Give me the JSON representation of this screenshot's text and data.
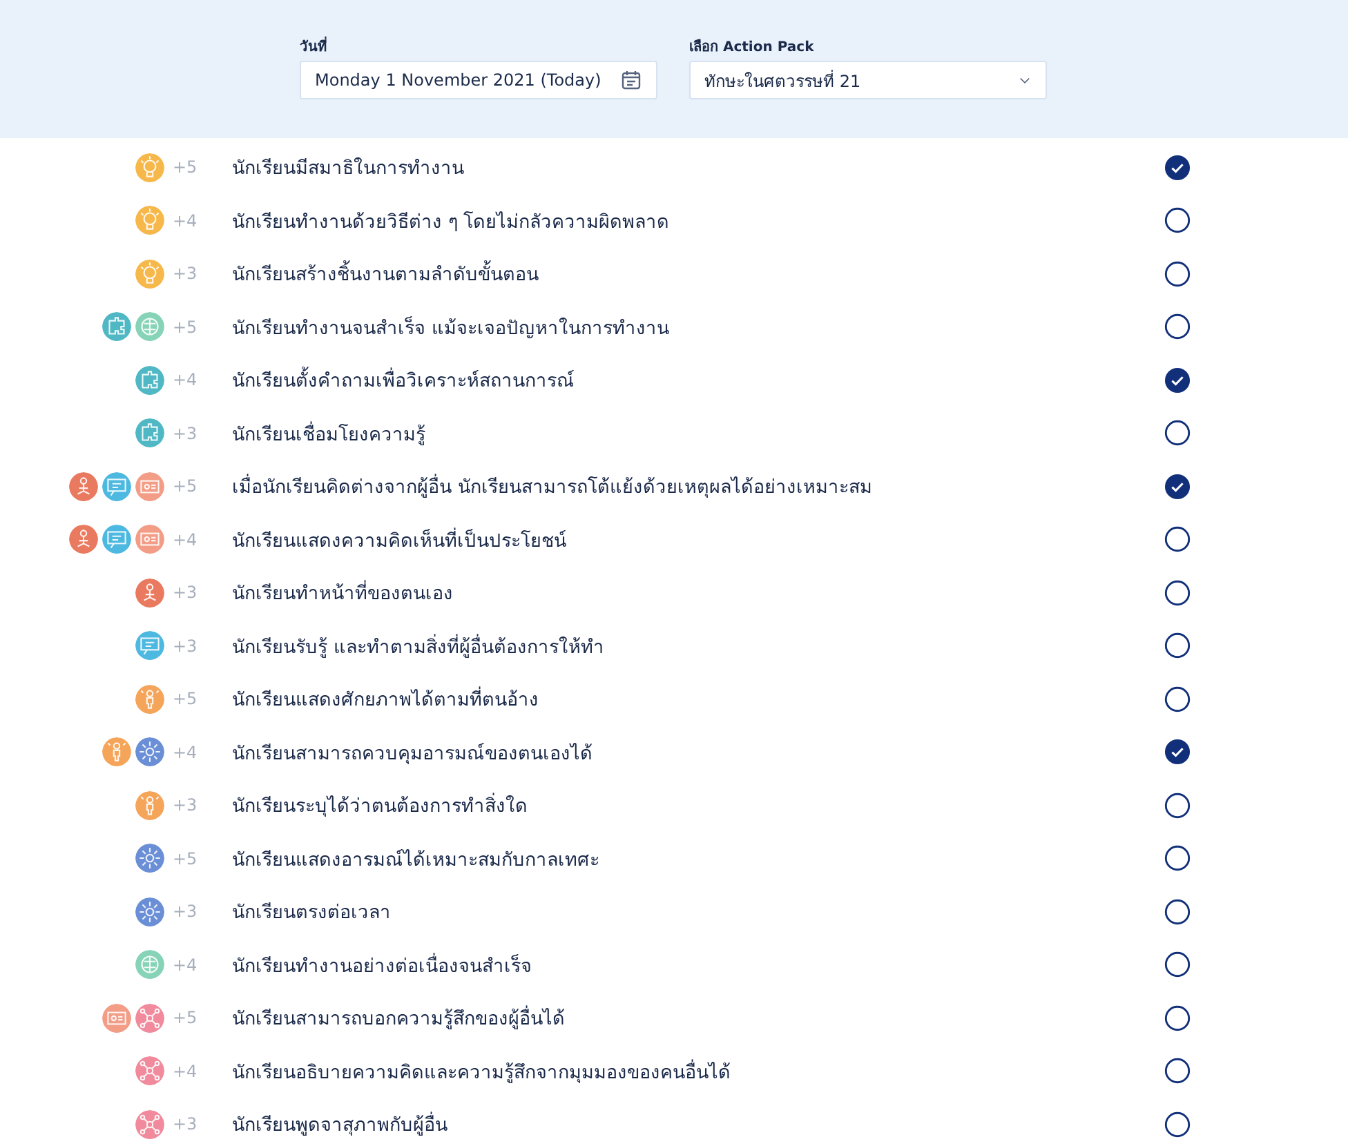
{
  "header": {
    "date_field": {
      "label": "วันที่",
      "value": "Monday 1 November 2021 (Today)"
    },
    "pack_select": {
      "label": "เลือก Action Pack",
      "value": "ทักษะในศตวรรษที่ 21"
    }
  },
  "items": [
    {
      "badges": [
        {
          "kind": "bulb",
          "color": "#f7b84b"
        }
      ],
      "points": "+5",
      "text": "นักเรียนมีสมาธิในการทำงาน",
      "checked": true
    },
    {
      "badges": [
        {
          "kind": "bulb",
          "color": "#f7b84b"
        }
      ],
      "points": "+4",
      "text": "นักเรียนทำงานด้วยวิธีต่าง ๆ โดยไม่กลัวความผิดพลาด",
      "checked": false
    },
    {
      "badges": [
        {
          "kind": "bulb",
          "color": "#f7b84b"
        }
      ],
      "points": "+3",
      "text": "นักเรียนสร้างชิ้นงานตามลำดับขั้นตอน",
      "checked": false
    },
    {
      "badges": [
        {
          "kind": "puzzle",
          "color": "#4fb8c4"
        },
        {
          "kind": "brain",
          "color": "#86d3b8"
        }
      ],
      "points": "+5",
      "text": "นักเรียนทำงานจนสำเร็จ แม้จะเจอปัญหาในการทำงาน",
      "checked": false
    },
    {
      "badges": [
        {
          "kind": "puzzle",
          "color": "#4fb8c4"
        }
      ],
      "points": "+4",
      "text": "นักเรียนตั้งคำถามเพื่อวิเคราะห์สถานการณ์",
      "checked": true
    },
    {
      "badges": [
        {
          "kind": "puzzle",
          "color": "#4fb8c4"
        }
      ],
      "points": "+3",
      "text": "นักเรียนเชื่อมโยงความรู้",
      "checked": false
    },
    {
      "badges": [
        {
          "kind": "people",
          "color": "#ea7a5f"
        },
        {
          "kind": "chat",
          "color": "#4db8e0"
        },
        {
          "kind": "card",
          "color": "#f39c86"
        }
      ],
      "points": "+5",
      "text": "เมื่อนักเรียนคิดต่างจากผู้อื่น นักเรียนสามารถโต้แย้งด้วยเหตุผลได้อย่างเหมาะสม",
      "checked": true
    },
    {
      "badges": [
        {
          "kind": "people",
          "color": "#ea7a5f"
        },
        {
          "kind": "chat",
          "color": "#4db8e0"
        },
        {
          "kind": "card",
          "color": "#f39c86"
        }
      ],
      "points": "+4",
      "text": "นักเรียนแสดงความคิดเห็นที่เป็นประโยชน์",
      "checked": false
    },
    {
      "badges": [
        {
          "kind": "people",
          "color": "#ea7a5f"
        }
      ],
      "points": "+3",
      "text": "นักเรียนทำหน้าที่ของตนเอง",
      "checked": false
    },
    {
      "badges": [
        {
          "kind": "chat",
          "color": "#4db8e0"
        }
      ],
      "points": "+3",
      "text": "นักเรียนรับรู้ และทำตามสิ่งที่ผู้อื่นต้องการให้ทำ",
      "checked": false
    },
    {
      "badges": [
        {
          "kind": "person",
          "color": "#f5a55a"
        }
      ],
      "points": "+5",
      "text": "นักเรียนแสดงศักยภาพได้ตามที่ตนอ้าง",
      "checked": false
    },
    {
      "badges": [
        {
          "kind": "person",
          "color": "#f5a55a"
        },
        {
          "kind": "gear",
          "color": "#6b8fd6"
        }
      ],
      "points": "+4",
      "text": "นักเรียนสามารถควบคุมอารมณ์ของตนเองได้",
      "checked": true
    },
    {
      "badges": [
        {
          "kind": "person",
          "color": "#f5a55a"
        }
      ],
      "points": "+3",
      "text": "นักเรียนระบุได้ว่าตนต้องการทำสิ่งใด",
      "checked": false
    },
    {
      "badges": [
        {
          "kind": "gear",
          "color": "#6b8fd6"
        }
      ],
      "points": "+5",
      "text": "นักเรียนแสดงอารมณ์ได้เหมาะสมกับกาลเทศะ",
      "checked": false
    },
    {
      "badges": [
        {
          "kind": "gear",
          "color": "#6b8fd6"
        }
      ],
      "points": "+3",
      "text": "นักเรียนตรงต่อเวลา",
      "checked": false
    },
    {
      "badges": [
        {
          "kind": "brain",
          "color": "#86d3b8"
        }
      ],
      "points": "+4",
      "text": "นักเรียนทำงานอย่างต่อเนื่องจนสำเร็จ",
      "checked": false
    },
    {
      "badges": [
        {
          "kind": "card",
          "color": "#f39c86"
        },
        {
          "kind": "network",
          "color": "#f08a9c"
        }
      ],
      "points": "+5",
      "text": "นักเรียนสามารถบอกความรู้สึกของผู้อื่นได้",
      "checked": false
    },
    {
      "badges": [
        {
          "kind": "network",
          "color": "#f08a9c"
        }
      ],
      "points": "+4",
      "text": "นักเรียนอธิบายความคิดและความรู้สึกจากมุมมองของคนอื่นได้",
      "checked": false
    },
    {
      "badges": [
        {
          "kind": "network",
          "color": "#f08a9c"
        }
      ],
      "points": "+3",
      "text": "นักเรียนพูดจาสุภาพกับผู้อื่น",
      "checked": false
    }
  ]
}
